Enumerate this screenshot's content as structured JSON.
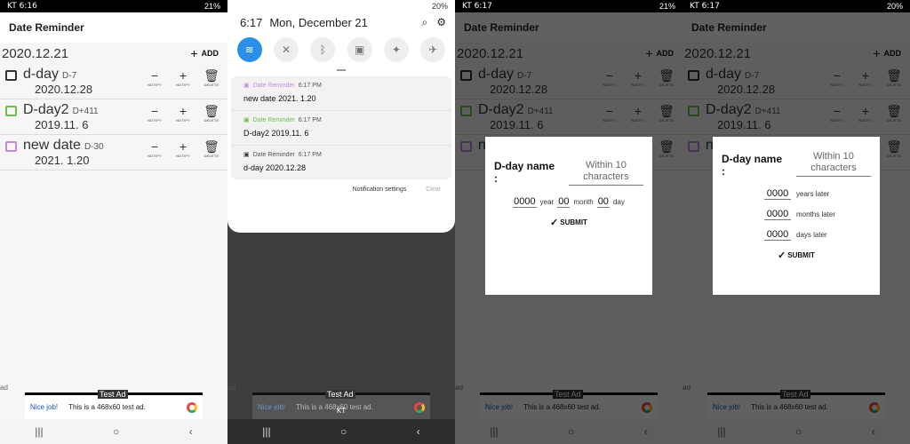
{
  "app": {
    "title": "Date Reminder",
    "current_date": "2020.12.21",
    "add_label": "ADD",
    "carrier": "KT",
    "status_time": "6:16",
    "status_time_2": "6:17",
    "battery_1": "21%",
    "battery_2": "20%"
  },
  "items": [
    {
      "name": "d-day",
      "dday": "D-7",
      "date": "2020.12.28",
      "color": "#333333"
    },
    {
      "name": "D-day2",
      "dday": "D+411",
      "date": "2019.11. 6",
      "color": "#6abf4b"
    },
    {
      "name": "new date",
      "dday": "D-30",
      "date": "2021. 1.20",
      "color": "#c38ae0"
    }
  ],
  "controls": {
    "notify": "NOTIFY",
    "delete": "DELETE",
    "minus": "−",
    "plus": "+"
  },
  "ad": {
    "label": "ad",
    "test_ad": "Test Ad",
    "nice": "Nice job!",
    "text": "This is a 468x60 test ad."
  },
  "shade": {
    "time": "6:17",
    "date": "Mon, December 21",
    "notifications": [
      {
        "app": "Date Reminder",
        "time": "6:17 PM",
        "body": "new date 2021. 1.20",
        "color": "#c38ae0"
      },
      {
        "app": "Date Reminder",
        "time": "6:17 PM",
        "body": "D-day2 2019.11. 6",
        "color": "#6abf4b"
      },
      {
        "app": "Date Reminder",
        "time": "6:17 PM",
        "body": "d-day 2020.12.28",
        "color": "#333333"
      }
    ],
    "settings": "Notification settings",
    "clear": "Clear",
    "carrier": "KT"
  },
  "dialog1": {
    "label": "D-day name :",
    "placeholder": "Within 10 characters",
    "year": "0000",
    "year_lbl": "year",
    "month": "00",
    "month_lbl": "month",
    "day": "00",
    "day_lbl": "day",
    "submit": "SUBMIT"
  },
  "dialog2": {
    "label": "D-day name :",
    "placeholder": "Within 10 characters",
    "years": "0000",
    "years_lbl": "years later",
    "months": "0000",
    "months_lbl": "months later",
    "days": "0000",
    "days_lbl": "days later",
    "submit": "SUBMIT"
  },
  "nav": {
    "recents": "|||",
    "home": "○",
    "back": "‹"
  }
}
